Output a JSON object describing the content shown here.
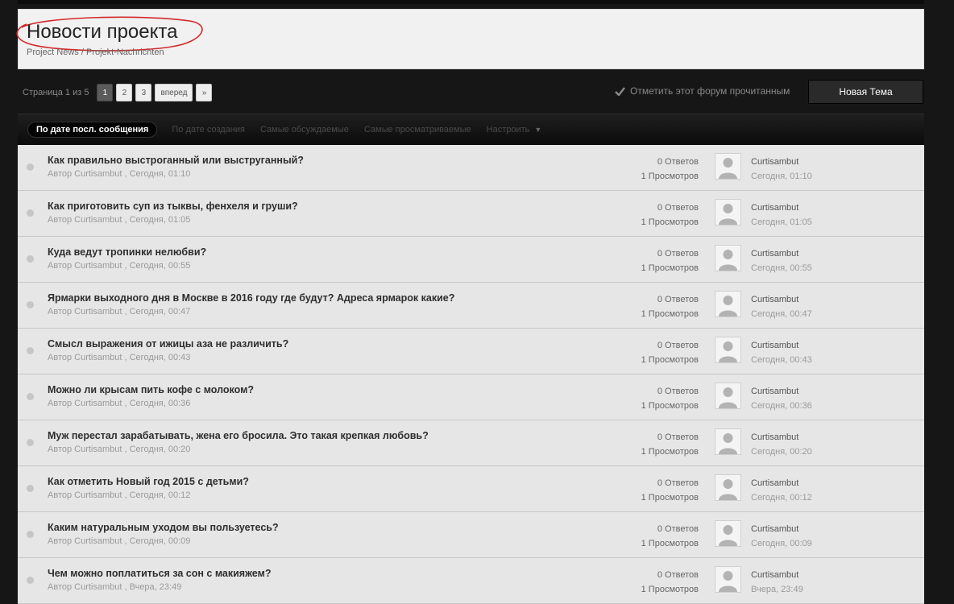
{
  "forum": {
    "title": "Новости проекта",
    "subtitle": "Project News / Projekt-Nachrichten",
    "annotation_color": "#d22a2a"
  },
  "pagination": {
    "label": "Страница 1 из 5",
    "pages": [
      "1",
      "2",
      "3"
    ],
    "current": "1",
    "next_label": "вперед",
    "last_label": "»"
  },
  "actions": {
    "mark_read_label": "Отметить этот форум прочитанным",
    "new_topic_label": "Новая Тема"
  },
  "sort": {
    "active": "По дате посл. сообщения",
    "options": [
      "По дате создания",
      "Самые обсуждаемые",
      "Самые просматриваемые"
    ],
    "customize_label": "Настроить"
  },
  "topics": [
    {
      "title": "Как правильно выстроганный или выструганный?",
      "meta": "Автор Curtisambut , Сегодня, 01:10",
      "replies": "0 Ответов",
      "views": "1 Просмотров",
      "last_author": "Curtisambut",
      "last_time": "Сегодня, 01:10"
    },
    {
      "title": "Как приготовить суп из тыквы, фенхеля и груши?",
      "meta": "Автор Curtisambut , Сегодня, 01:05",
      "replies": "0 Ответов",
      "views": "1 Просмотров",
      "last_author": "Curtisambut",
      "last_time": "Сегодня, 01:05"
    },
    {
      "title": "Куда ведут тропинки нелюбви?",
      "meta": "Автор Curtisambut , Сегодня, 00:55",
      "replies": "0 Ответов",
      "views": "1 Просмотров",
      "last_author": "Curtisambut",
      "last_time": "Сегодня, 00:55"
    },
    {
      "title": "Ярмарки выходного дня в Москве в 2016 году где будут? Адреса ярмарок какие?",
      "meta": "Автор Curtisambut , Сегодня, 00:47",
      "replies": "0 Ответов",
      "views": "1 Просмотров",
      "last_author": "Curtisambut",
      "last_time": "Сегодня, 00:47"
    },
    {
      "title": "Смысл выражения от ижицы аза не различить?",
      "meta": "Автор Curtisambut , Сегодня, 00:43",
      "replies": "0 Ответов",
      "views": "1 Просмотров",
      "last_author": "Curtisambut",
      "last_time": "Сегодня, 00:43"
    },
    {
      "title": "Можно ли крысам пить кофе с молоком?",
      "meta": "Автор Curtisambut , Сегодня, 00:36",
      "replies": "0 Ответов",
      "views": "1 Просмотров",
      "last_author": "Curtisambut",
      "last_time": "Сегодня, 00:36"
    },
    {
      "title": "Муж перестал зарабатывать, жена его бросила. Это такая крепкая любовь?",
      "meta": "Автор Curtisambut , Сегодня, 00:20",
      "replies": "0 Ответов",
      "views": "1 Просмотров",
      "last_author": "Curtisambut",
      "last_time": "Сегодня, 00:20"
    },
    {
      "title": "Как отметить Новый год 2015 с детьми?",
      "meta": "Автор Curtisambut , Сегодня, 00:12",
      "replies": "0 Ответов",
      "views": "1 Просмотров",
      "last_author": "Curtisambut",
      "last_time": "Сегодня, 00:12"
    },
    {
      "title": "Каким натуральным уходом вы пользуетесь?",
      "meta": "Автор Curtisambut , Сегодня, 00:09",
      "replies": "0 Ответов",
      "views": "1 Просмотров",
      "last_author": "Curtisambut",
      "last_time": "Сегодня, 00:09"
    },
    {
      "title": "Чем можно поплатиться за сон с макияжем?",
      "meta": "Автор Curtisambut , Вчера, 23:49",
      "replies": "0 Ответов",
      "views": "1 Просмотров",
      "last_author": "Curtisambut",
      "last_time": "Вчера, 23:49"
    }
  ]
}
